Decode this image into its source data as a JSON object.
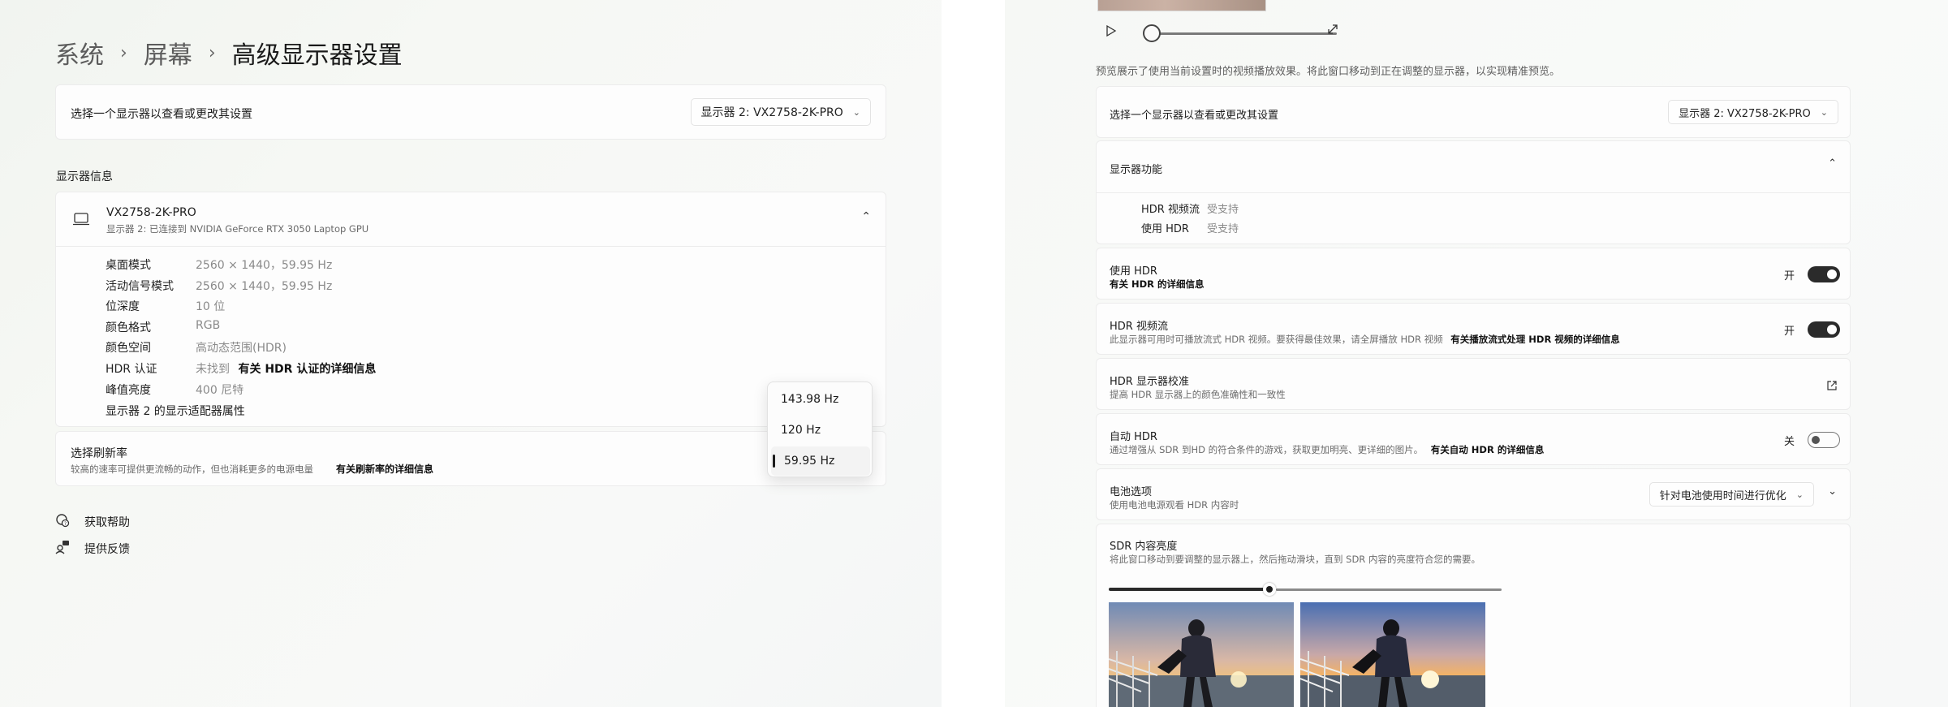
{
  "left": {
    "breadcrumb": [
      "系统",
      "屏幕",
      "高级显示器设置"
    ],
    "breadcrumb_sep": "›",
    "select_display": {
      "label": "选择一个显示器以查看或更改其设置",
      "value": "显示器 2: VX2758-2K-PRO"
    },
    "info_section_title": "显示器信息",
    "monitor": {
      "name": "VX2758-2K-PRO",
      "connection": "显示器 2: 已连接到 NVIDIA GeForce RTX 3050 Laptop GPU"
    },
    "info_rows": [
      {
        "key": "桌面模式",
        "value": "2560 × 1440，59.95 Hz"
      },
      {
        "key": "活动信号模式",
        "value": "2560 × 1440，59.95 Hz"
      },
      {
        "key": "位深度",
        "value": "10 位"
      },
      {
        "key": "颜色格式",
        "value": "RGB"
      },
      {
        "key": "颜色空间",
        "value": "高动态范围(HDR)"
      },
      {
        "key": "HDR 认证",
        "value_prefix": "未找到",
        "value_link": "有关 HDR 认证的详细信息"
      },
      {
        "key": "峰值亮度",
        "value": "400 尼特"
      }
    ],
    "adapter_link": "显示器 2 的显示适配器属性",
    "refresh_rate": {
      "title": "选择刷新率",
      "desc": "较高的速率可提供更流畅的动作，但也消耗更多的电源电量",
      "link": "有关刷新率的详细信息",
      "options": [
        "143.98 Hz",
        "120 Hz",
        "59.95 Hz"
      ],
      "selected": "59.95 Hz"
    },
    "help": "获取帮助",
    "feedback": "提供反馈"
  },
  "right": {
    "preview_note": "预览展示了使用当前设置时的视频播放效果。将此窗口移动到正在调整的显示器，以实现精准预览。",
    "select_display": {
      "label": "选择一个显示器以查看或更改其设置",
      "value": "显示器 2: VX2758-2K-PRO"
    },
    "capabilities": {
      "title": "显示器功能",
      "rows": [
        {
          "key": "HDR 视频流",
          "value": "受支持"
        },
        {
          "key": "使用 HDR",
          "value": "受支持"
        }
      ]
    },
    "use_hdr": {
      "title": "使用 HDR",
      "link": "有关 HDR 的详细信息",
      "state": "开"
    },
    "hdr_stream": {
      "title": "HDR 视频流",
      "desc": "此显示器可用时可播放流式 HDR 视频。要获得最佳效果，请全屏播放 HDR 视频",
      "link": "有关播放流式处理 HDR 视频的详细信息",
      "state": "开"
    },
    "hdr_calibration": {
      "title": "HDR 显示器校准",
      "desc": "提高 HDR 显示器上的颜色准确性和一致性"
    },
    "auto_hdr": {
      "title": "自动 HDR",
      "desc": "通过增强从 SDR 到HD 的符合条件的游戏，获取更加明亮、更详细的图片。",
      "link": "有关自动 HDR 的详细信息",
      "state": "关"
    },
    "battery": {
      "title": "电池选项",
      "desc": "使用电池电源观看 HDR 内容时",
      "value": "针对电池使用时间进行优化"
    },
    "sdr": {
      "title": "SDR 内容亮度",
      "desc": "将此窗口移动到要调整的显示器上，然后拖动滑块，直到 SDR 内容的亮度符合您的需要。",
      "brightness_fraction": 0.41
    }
  }
}
